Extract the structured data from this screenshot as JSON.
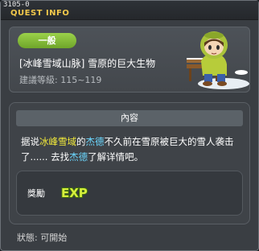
{
  "window": {
    "quest_id": "3105-0",
    "title": "QUEST INFO"
  },
  "header": {
    "category": "一般",
    "quest_name": "[冰峰雪域山脉] 雪原的巨大生物",
    "level_requirement": "建議等級: 115~119",
    "npc_icon": "npc-portrait-icon"
  },
  "content": {
    "section_title": "內容",
    "desc": {
      "p1": "据说",
      "loc": "冰峰雪域",
      "p2": "的",
      "npc1": "杰德",
      "p3": "不久前在雪原被巨大的雪人袭击了...... 去找",
      "npc2": "杰德",
      "p4": "了解详情吧。"
    },
    "reward": {
      "label": "獎勵",
      "exp_icon": "exp-icon",
      "exp_text": "EXP"
    }
  },
  "status": "狀態: 可開始",
  "colors": {
    "accent_yellow": "#f2c84b",
    "tag_green": "#7db632",
    "highlight_yellow": "#f2ea3a",
    "highlight_cyan": "#6bd8ff"
  }
}
